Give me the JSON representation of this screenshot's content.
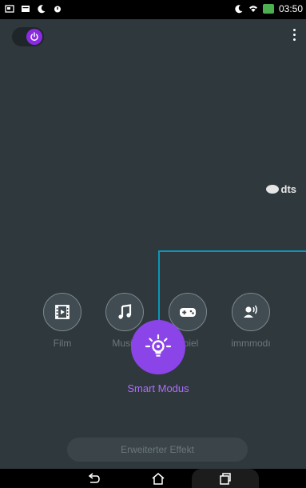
{
  "status_bar": {
    "time": "03:50",
    "left_icons": [
      "screenshot-icon",
      "message-icon",
      "moon-icon",
      "alarm-icon"
    ],
    "right_icons": [
      "moon-icon",
      "wifi-icon",
      "battery-icon"
    ]
  },
  "power_toggle": {
    "state": "on",
    "accent": "#8a2be2"
  },
  "brand": {
    "logo": "dts"
  },
  "modes": [
    {
      "label": "Film",
      "icon": "film-icon"
    },
    {
      "label": "Musik",
      "icon": "music-icon"
    },
    {
      "label": "Spiel",
      "icon": "gamepad-icon"
    },
    {
      "label": "immmodı",
      "icon": "voice-icon"
    }
  ],
  "smart_mode": {
    "label": "Smart Modus",
    "icon": "lightbulb-icon",
    "accent": "#8a44e8"
  },
  "advanced_button": {
    "label": "Erweiterter Effekt"
  },
  "nav_bar": {
    "buttons": [
      "back-icon",
      "home-icon",
      "recent-apps-icon"
    ]
  }
}
